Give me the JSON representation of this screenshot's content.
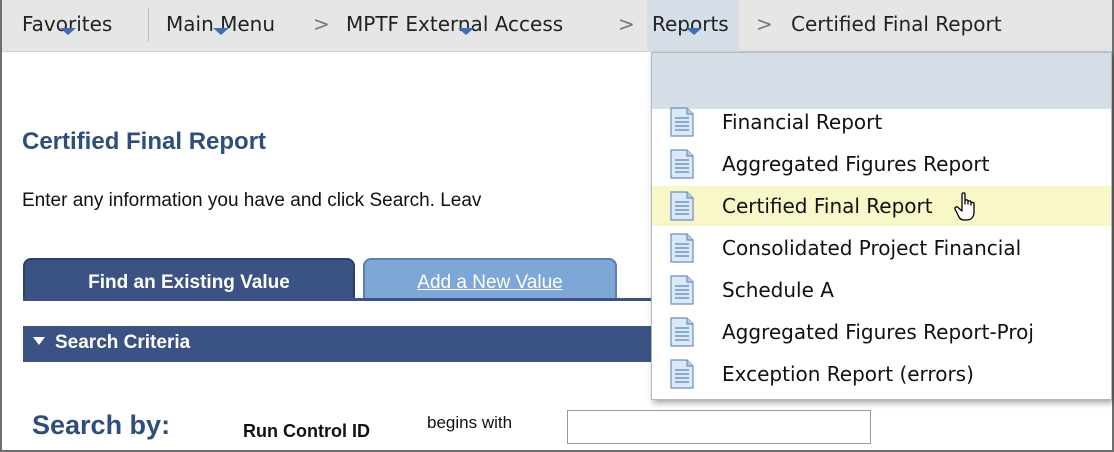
{
  "nav": {
    "favorites": "Favorites",
    "main_menu": "Main Menu",
    "mptf": "MPTF External Access",
    "reports": "Reports",
    "current": "Certified Final Report",
    "separator": ">"
  },
  "page": {
    "title": "Certified Final Report",
    "instructions": "Enter any information you have and click Search. Leav"
  },
  "tabs": {
    "find": "Find an Existing Value",
    "add": "Add a New Value"
  },
  "search": {
    "criteria_label": "Search Criteria",
    "search_by": "Search by:",
    "run_control_label": "Run Control ID",
    "operator": "begins with",
    "run_control_value": ""
  },
  "dropdown": {
    "items": [
      {
        "label": "Financial Report"
      },
      {
        "label": "Aggregated Figures Report"
      },
      {
        "label": "Certified Final Report"
      },
      {
        "label": "Consolidated Project Financial"
      },
      {
        "label": "Schedule A"
      },
      {
        "label": "Aggregated Figures Report-Proj"
      },
      {
        "label": "Exception Report (errors)"
      }
    ],
    "hovered_index": 2
  },
  "colors": {
    "accent": "#3b5285",
    "title": "#2d4e7e",
    "nav_arrow": "#3d6fb0",
    "hover": "#f7f7c8"
  }
}
